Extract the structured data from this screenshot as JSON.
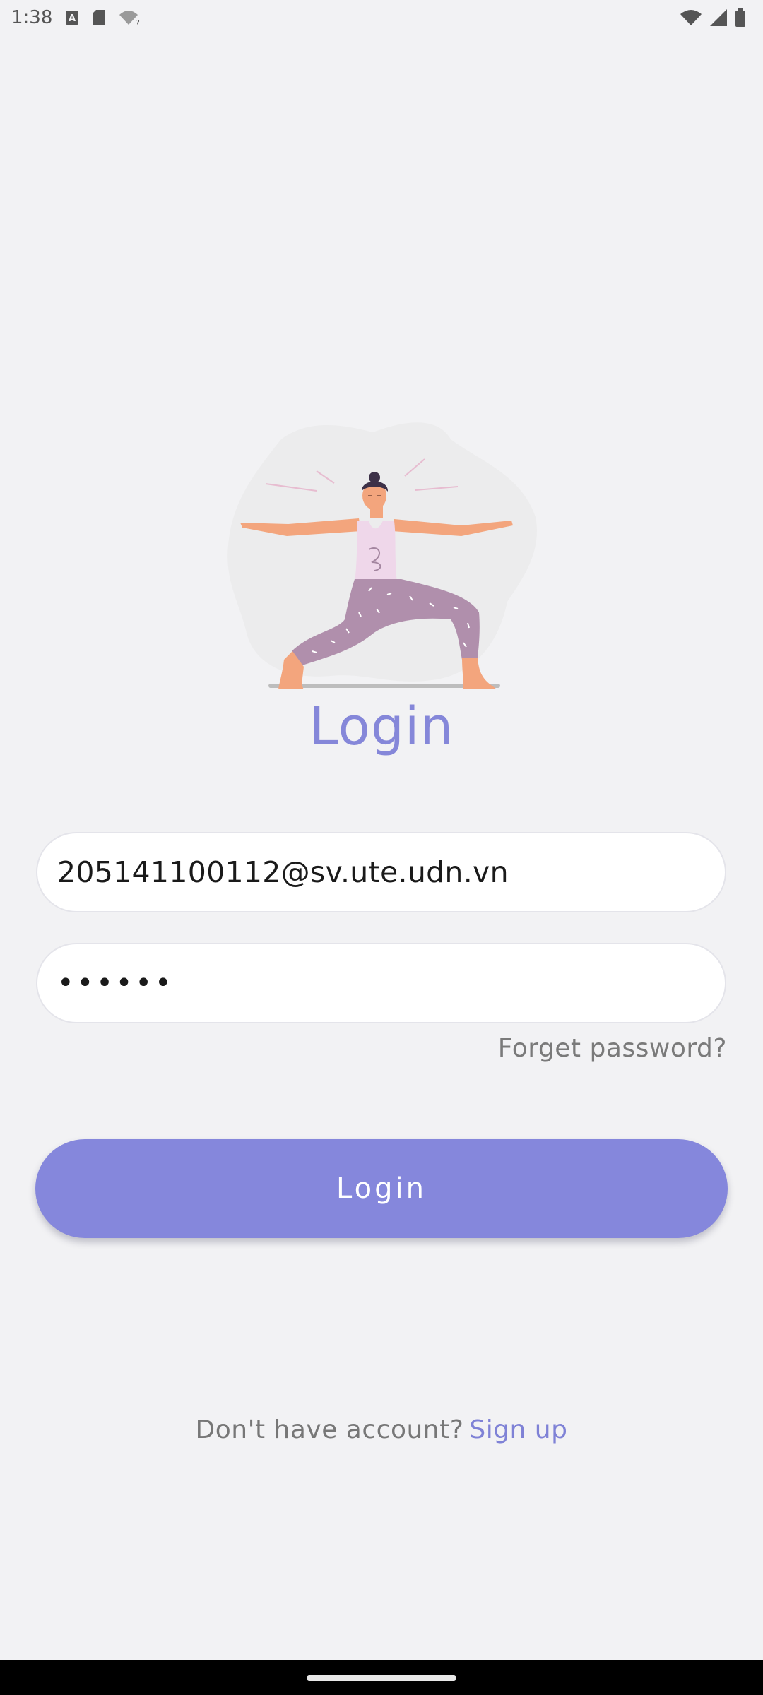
{
  "status_bar": {
    "time": "1:38",
    "left_icons": [
      "font-a-icon",
      "sd-card-icon",
      "wifi-unknown-icon"
    ],
    "right_icons": [
      "wifi-icon",
      "signal-icon",
      "battery-icon"
    ]
  },
  "illustration": {
    "icon": "yoga-person-illustration"
  },
  "login": {
    "title": "Login",
    "email_value": "205141100112@sv.ute.udn.vn",
    "password_value": "••••••",
    "forget_password": "Forget password?",
    "button_label": "Login"
  },
  "signup": {
    "prompt": "Don't have account?",
    "link": "Sign up"
  },
  "colors": {
    "accent": "#8587dc",
    "title": "#8587d9",
    "background": "#f2f2f4"
  }
}
